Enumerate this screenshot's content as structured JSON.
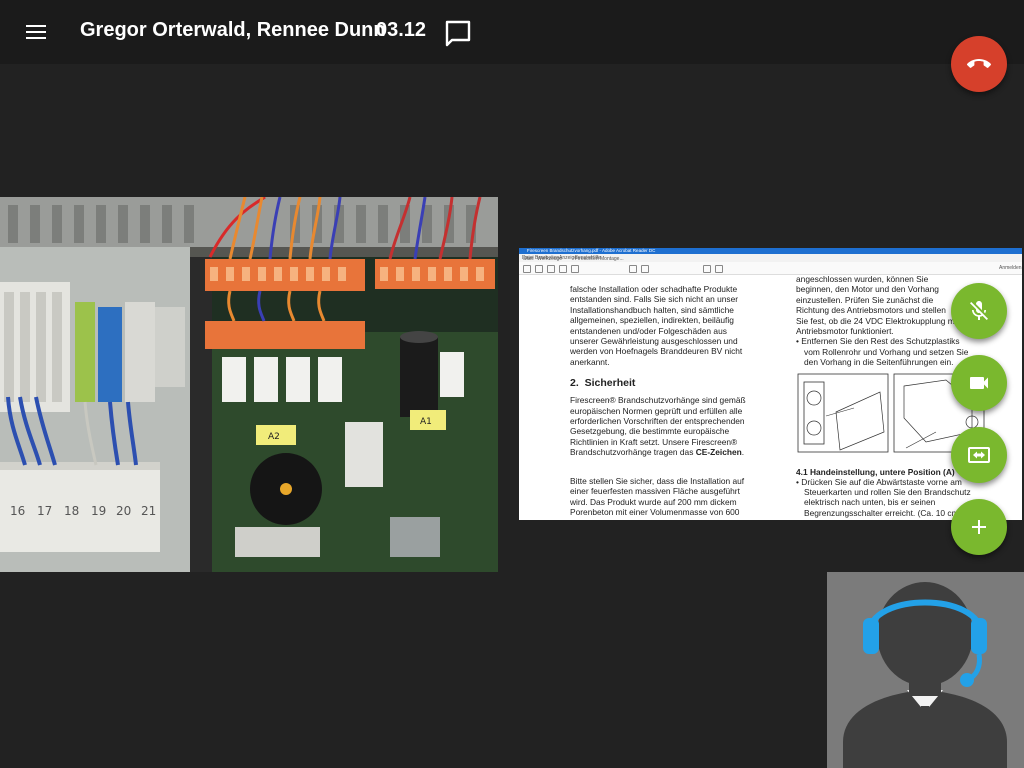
{
  "header": {
    "menu_icon": "hamburger-menu-icon",
    "title": "Gregor Orterwald, Rennee Dunn",
    "duration": "03.12",
    "chat_icon": "chat-bubble-icon"
  },
  "actions": {
    "hangup_icon": "phone-hangup-icon",
    "mic_off_icon": "mic-off-icon",
    "camera_icon": "videocam-icon",
    "swap_icon": "swap-view-icon",
    "add_icon": "add-icon"
  },
  "colors": {
    "hangup": "#d6402b",
    "action": "#7ab82e",
    "background": "#222222",
    "topbar": "#1b1b1b"
  },
  "shared_document": {
    "title_bar_text": "Firescreen Brandschutzvorhang.pdf - Adobe Acrobat Reader DC",
    "menu": [
      "Datei",
      "Bearbeiten",
      "Anzeige",
      "Fenster",
      "Hilfe"
    ],
    "tabs": [
      "Start",
      "Werkzeuge",
      "Firescreen Montage..."
    ],
    "toolbar_right": "Anmelden",
    "left_column": [
      "falsche Installation oder schadhafte Produkte",
      "entstanden sind. Falls Sie sich nicht an unser",
      "Installationshandbuch halten, sind sämtliche",
      "allgemeinen, speziellen, indirekten, beiläufig",
      "entstandenen und/oder Folgeschäden aus",
      "unserer Gewährleistung ausgeschlossen und",
      "werden von Hoefnagels Branddeuren BV nicht",
      "anerkannt."
    ],
    "section_number": "2.",
    "section_title": "Sicherheit",
    "section_lines": [
      "Firescreen® Brandschutzvorhänge sind gemäß",
      "europäischen Normen geprüft und erfüllen alle",
      "erforderlichen Vorschriften der entsprechenden",
      "Gesetzgebung, die bestimmte europäische",
      "Richtlinien in Kraft setzt. Unsere Firescreen®",
      "Brandschutzvorhänge tragen das"
    ],
    "section_emphasis": "CE-Zeichen",
    "install_lines": [
      "Bitte stellen Sie sicher, dass die Installation auf",
      "einer feuerfesten massiven Fläche ausgeführt",
      "wird. Das Produkt wurde auf 200 mm dickem",
      "Porenbeton mit einer Volumenmasse von 600"
    ],
    "right_column": [
      "angeschlossen wurden, können Sie",
      "beginnen, den Motor und den Vorhang",
      "einzustellen. Prüfen Sie zunächst die",
      "Richtung des Antriebsmotors und stellen",
      "Sie fest, ob die 24 VDC Elektrokupplung m",
      "Antriebsmotor funktioniert."
    ],
    "right_bullet": [
      "Entfernen Sie den Rest des Schutzplastiks",
      "vom Rollenrohr und Vorhang und setzen Sie",
      "den Vorhang in die Seitenführungen ein."
    ],
    "subsection_title": "4.1 Handeinstellung, untere Position (A)",
    "subsection_bullet": [
      "Drücken Sie auf die Abwärtstaste vorne am",
      "Steuerkarten und rollen Sie den Brandschutz",
      "elektrisch nach unten, bis er seinen",
      "Begrenzungsschalter erreicht. (Ca. 10 cm"
    ]
  },
  "video": {
    "terminal_numbers": [
      "16",
      "17",
      "18",
      "19",
      "20",
      "21"
    ],
    "label_a": "A2",
    "label_b": "A1"
  },
  "self_view": {
    "avatar_icon": "person-headset-icon"
  }
}
